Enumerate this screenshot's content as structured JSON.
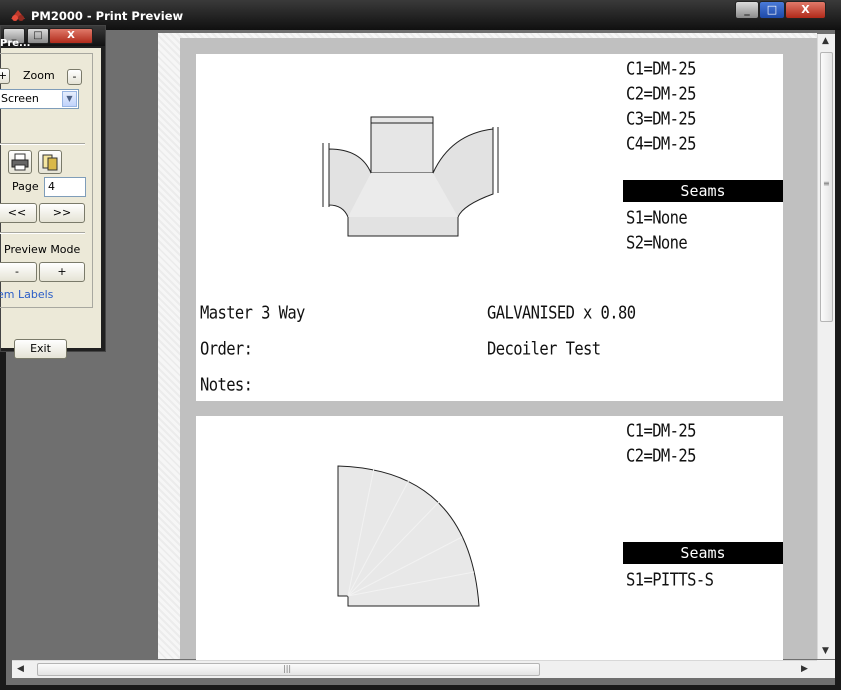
{
  "window": {
    "title": "PM2000 - Print Preview",
    "min_label": "_",
    "max_label": "□",
    "close_label": "X"
  },
  "panel": {
    "title": "Pre...",
    "min_label": "_",
    "max_label": "□",
    "close_label": "X",
    "zoom_in_label": "+",
    "zoom_label": "Zoom",
    "zoom_out_label": "-",
    "zoom_value": "Screen",
    "page_label": "Page",
    "page_value": "4",
    "prev_label": "<<",
    "next_label": ">>",
    "preview_mode_label": "Preview Mode",
    "mode_minus_label": "-",
    "mode_plus_label": "+",
    "element_labels_link": "em Labels",
    "exit_label": "Exit"
  },
  "pages": [
    {
      "connectors": [
        "C1=DM-25",
        "C2=DM-25",
        "C3=DM-25",
        "C4=DM-25"
      ],
      "seams_header": "Seams",
      "seams": [
        "S1=None",
        "S2=None"
      ],
      "item_name": "Master 3 Way",
      "material": "GALVANISED x 0.80",
      "order_label": "Order:",
      "order_value": "Decoiler Test",
      "notes_label": "Notes:"
    },
    {
      "connectors": [
        "C1=DM-25",
        "C2=DM-25"
      ],
      "seams_header": "Seams",
      "seams": [
        "S1=PITTS-S"
      ]
    }
  ],
  "colors": {
    "accent_blue": "#2a5dc7",
    "seams_bar": "#000000",
    "close_red": "#c0392b"
  }
}
